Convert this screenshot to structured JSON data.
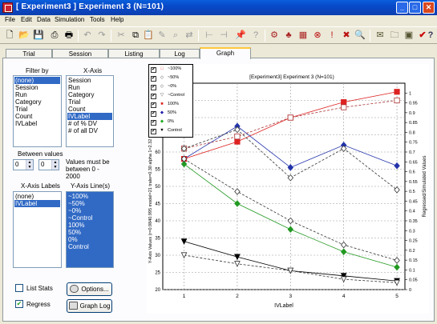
{
  "window": {
    "title": "[ Experiment3 ] Experiment 3 (N=101)"
  },
  "menu": [
    "File",
    "Edit",
    "Data",
    "Simulation",
    "Tools",
    "Help"
  ],
  "tabs": [
    "Trial",
    "Session",
    "Listing",
    "Log",
    "Graph"
  ],
  "filter_by": {
    "label": "Filter by",
    "items": [
      "(none)",
      "Session",
      "Run",
      "Category",
      "Trial",
      "Count",
      "IVLabel"
    ],
    "selected": "(none)"
  },
  "x_axis": {
    "label": "X-Axis",
    "items": [
      "Session",
      "Run",
      "Category",
      "Trial",
      "Count",
      "IVLabel",
      "# of % DV",
      "# of all DV"
    ],
    "selected": "IVLabel"
  },
  "between_values": {
    "label": "Between values",
    "from": "0",
    "to": "0",
    "note": "Values must be between 0 - 2000"
  },
  "x_axis_labels": {
    "label": "X-Axis Labels",
    "items": [
      "(none)",
      "IVLabel"
    ],
    "selected": "IVLabel"
  },
  "y_axis_lines": {
    "label": "Y-Axis Line(s)",
    "items": [
      "~100%",
      "~50%",
      "~0%",
      "~Control",
      "100%",
      "50%",
      "0%",
      "Control"
    ]
  },
  "options_button": "Options...",
  "graph_log_button": "Graph Log",
  "list_stats": "List Stats",
  "regress": "Regress",
  "legend": [
    {
      "label": "~100%",
      "marker": "□",
      "color": "#d33"
    },
    {
      "label": "~50%",
      "marker": "◇",
      "color": "#333"
    },
    {
      "label": "~0%",
      "marker": "◇",
      "color": "#333"
    },
    {
      "label": "~Control",
      "marker": "▽",
      "color": "#333"
    },
    {
      "label": "100%",
      "marker": "■",
      "color": "#d22"
    },
    {
      "label": "50%",
      "marker": "◆",
      "color": "#22a"
    },
    {
      "label": "0%",
      "marker": "◆",
      "color": "#2a2"
    },
    {
      "label": "Control",
      "marker": "▼",
      "color": "#000"
    }
  ],
  "chart_data": {
    "type": "line",
    "title": "[Experiment3] Experiment 3 (N=101)",
    "xlabel": "IVLabel",
    "ylabel": "Y-Axis Values (r=0.9840.995 model=21 tralw=0.30 alpha 1=2.32 alpha_n=0.50)",
    "ylabel_right": "Regressed/Simulated Values",
    "x": [
      1,
      2,
      3,
      4,
      5
    ],
    "ylim": [
      20,
      80
    ],
    "y_ticks": [
      20,
      25,
      30,
      35,
      40,
      45,
      50,
      55,
      60,
      65,
      70,
      75
    ],
    "y2lim": [
      0,
      1.05
    ],
    "y2_ticks": [
      0,
      0.05,
      0.1,
      0.15,
      0.2,
      0.25,
      0.3,
      0.35,
      0.4,
      0.45,
      0.5,
      0.55,
      0.6,
      0.65,
      0.7,
      0.75,
      0.8,
      0.85,
      0.9,
      0.95,
      1
    ],
    "grid": true,
    "series": [
      {
        "name": "100%",
        "values": [
          58,
          63,
          70,
          74.5,
          77.5
        ],
        "color": "#dd2222",
        "marker": "square-filled",
        "dashed": false
      },
      {
        "name": "50%",
        "values": [
          58,
          67.5,
          55.5,
          62,
          56
        ],
        "color": "#2233aa",
        "marker": "diamond-filled",
        "dashed": false
      },
      {
        "name": "0%",
        "values": [
          56.5,
          45,
          37.5,
          31,
          26.5
        ],
        "color": "#229922",
        "marker": "diamond-filled",
        "dashed": false
      },
      {
        "name": "Control",
        "values": [
          34,
          29.5,
          25.5,
          24,
          22.5
        ],
        "color": "#000000",
        "marker": "triangle-filled",
        "dashed": false
      },
      {
        "name": "~100%",
        "values": [
          61,
          64.5,
          70,
          73,
          75
        ],
        "color": "#aa3333",
        "marker": "square-open",
        "dashed": true
      },
      {
        "name": "~50%",
        "values": [
          61,
          66.5,
          52.5,
          61,
          49
        ],
        "color": "#333333",
        "marker": "diamond-open",
        "dashed": true
      },
      {
        "name": "~0%",
        "values": [
          58,
          48.5,
          40,
          33,
          28.5
        ],
        "color": "#333333",
        "marker": "diamond-open",
        "dashed": true
      },
      {
        "name": "~Control",
        "values": [
          30,
          27.5,
          25.5,
          23,
          22
        ],
        "color": "#333333",
        "marker": "triangle-open",
        "dashed": true
      }
    ]
  }
}
